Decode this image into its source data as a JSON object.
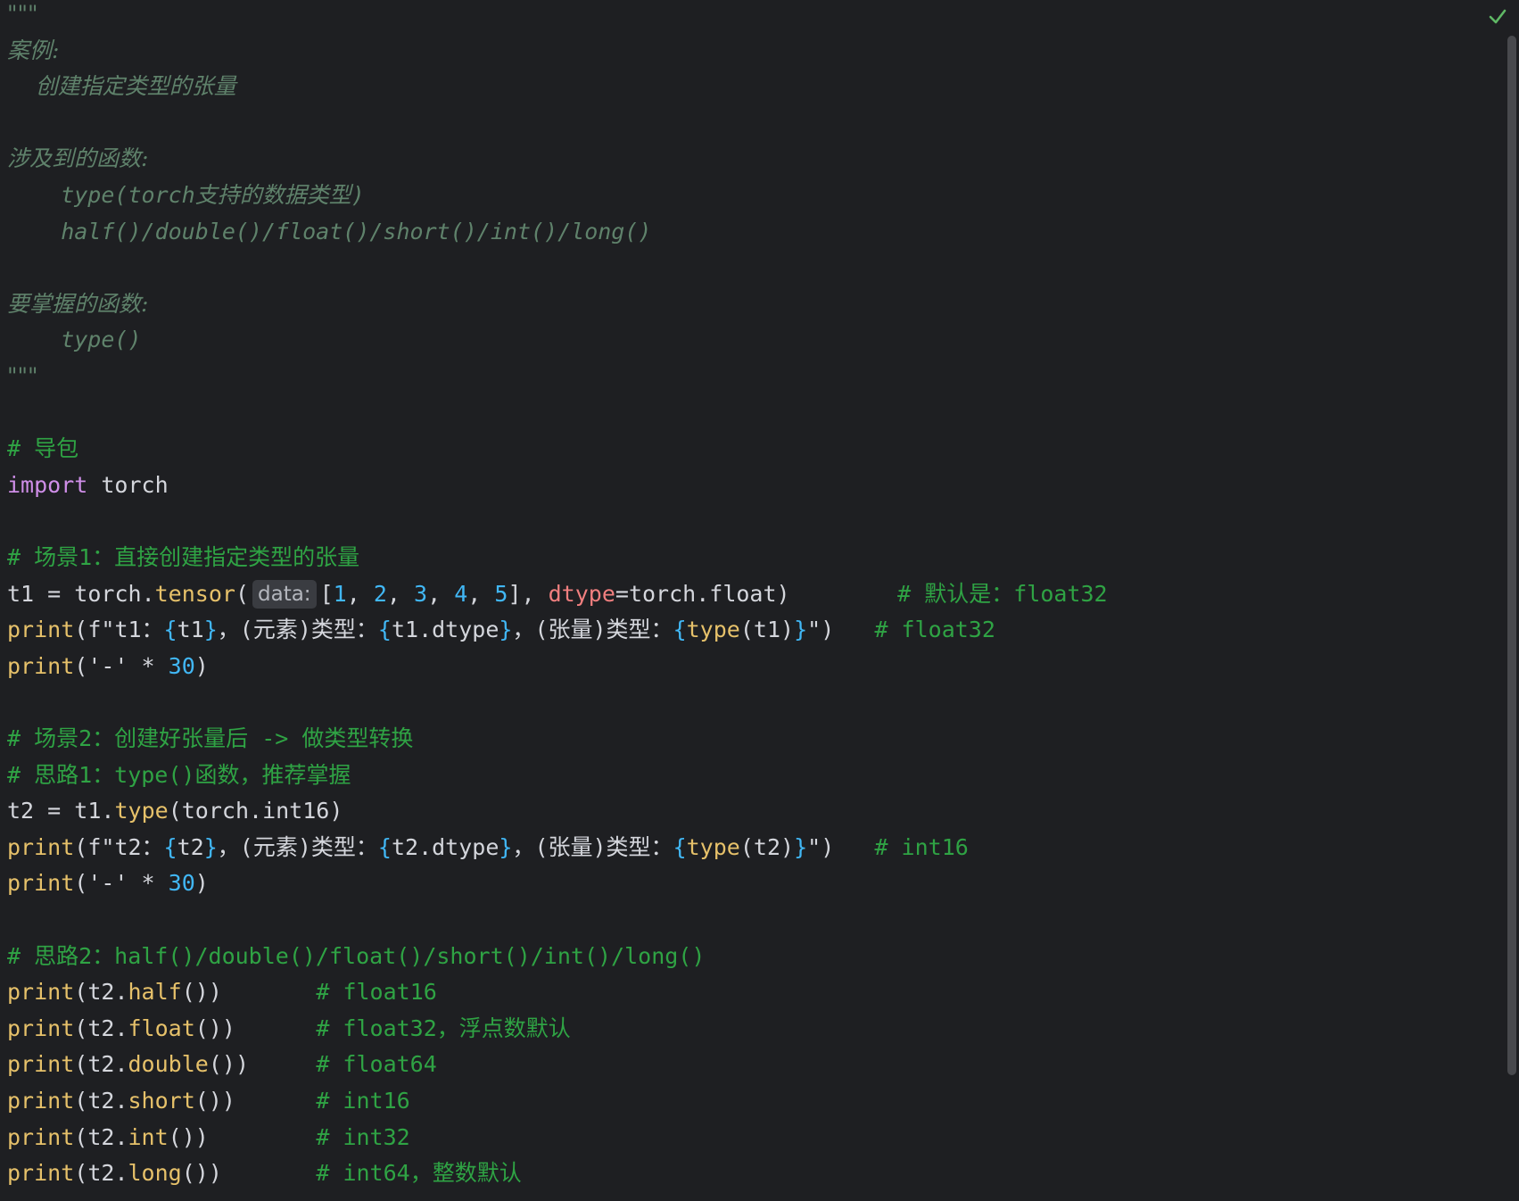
{
  "editor": {
    "language": "python",
    "status_icon": "check-icon",
    "inlay_hint": "data:",
    "lines": [
      "\"\"\"",
      "案例:",
      "    创建指定类型的张量",
      "",
      "涉及到的函数:",
      "    type(torch支持的数据类型)",
      "    half()/double()/float()/short()/int()/long()",
      "",
      "要掌握的函数:",
      "    type()",
      "\"\"\"",
      "",
      "# 导包",
      "import torch",
      "",
      "# 场景1：直接创建指定类型的张量",
      "t1 = torch.tensor([1, 2, 3, 4, 5], dtype=torch.float)        # 默认是：float32",
      "print(f\"t1：{t1}，(元素)类型：{t1.dtype}，(张量)类型：{type(t1)}\")   # float32",
      "print('-' * 30)",
      "",
      "# 场景2：创建好张量后 -> 做类型转换",
      "# 思路1：type()函数，推荐掌握",
      "t2 = t1.type(torch.int16)",
      "print(f\"t2：{t2}，(元素)类型：{t2.dtype}，(张量)类型：{type(t2)}\")   # int16",
      "print('-' * 30)",
      "",
      "# 思路2：half()/double()/float()/short()/int()/long()",
      "print(t2.half())       # float16",
      "print(t2.float())      # float32，浮点数默认",
      "print(t2.double())     # float64",
      "print(t2.short())      # int16",
      "print(t2.int())        # int32",
      "print(t2.long())       # int64，整数默认"
    ],
    "current_line": 33
  }
}
